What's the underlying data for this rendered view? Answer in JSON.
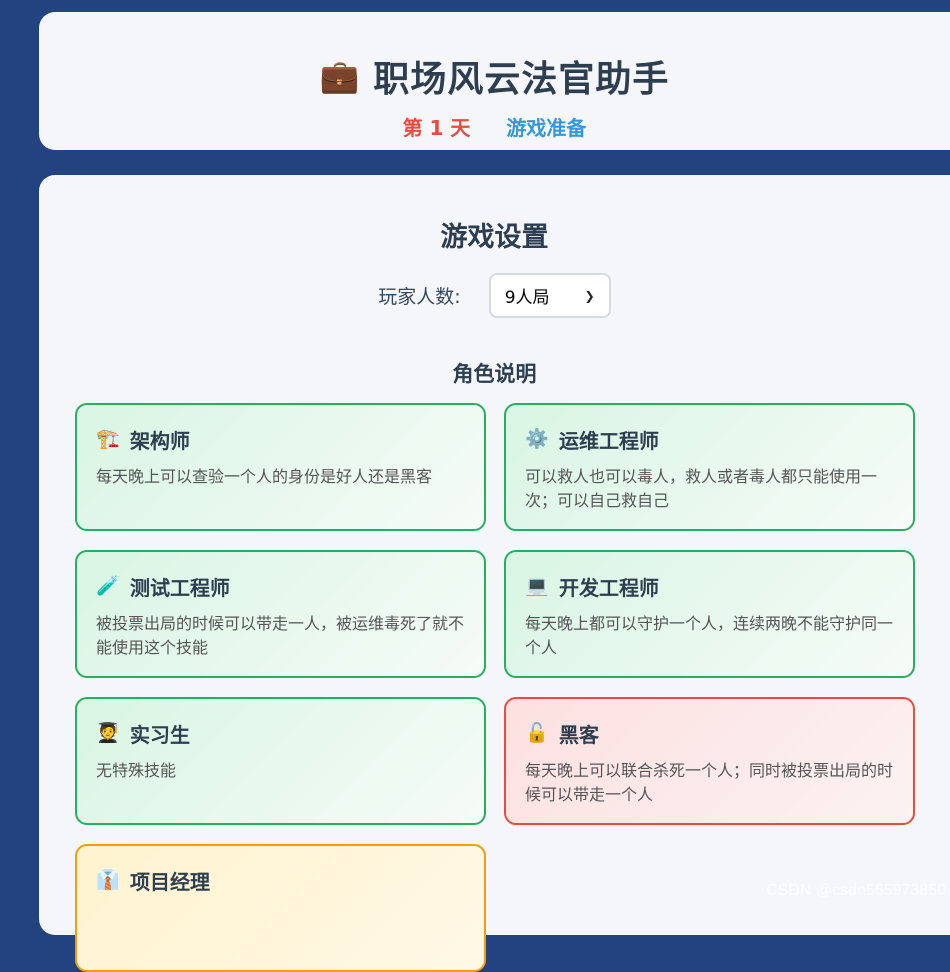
{
  "header": {
    "icon": "briefcase-icon",
    "icon_glyph": "💼",
    "title": "职场风云法官助手",
    "day": "第 1 天",
    "phase": "游戏准备"
  },
  "settings": {
    "title": "游戏设置",
    "players_label": "玩家人数:",
    "players_value": "9人局",
    "roles_title": "角色说明"
  },
  "roles": [
    {
      "icon": "crane-icon",
      "glyph": "🏗️",
      "name": "架构师",
      "desc": "每天晚上可以查验一个人的身份是好人还是黑客",
      "team": "good"
    },
    {
      "icon": "gear-icon",
      "glyph": "⚙️",
      "name": "运维工程师",
      "desc": "可以救人也可以毒人，救人或者毒人都只能使用一次；可以自己救自己",
      "team": "good"
    },
    {
      "icon": "test-tube-icon",
      "glyph": "🧪",
      "name": "测试工程师",
      "desc": "被投票出局的时候可以带走一人，被运维毒死了就不能使用这个技能",
      "team": "good"
    },
    {
      "icon": "laptop-icon",
      "glyph": "💻",
      "name": "开发工程师",
      "desc": "每天晚上都可以守护一个人，连续两晚不能守护同一个人",
      "team": "good"
    },
    {
      "icon": "student-icon",
      "glyph": "🧑‍🎓",
      "name": "实习生",
      "desc": "无特殊技能",
      "team": "good"
    },
    {
      "icon": "unlock-icon",
      "glyph": "🔓",
      "name": "黑客",
      "desc": "每天晚上可以联合杀死一个人；同时被投票出局的时候可以带走一个人",
      "team": "evil"
    },
    {
      "icon": "suit-icon",
      "glyph": "👔",
      "name": "项目经理",
      "desc": "",
      "team": "special"
    }
  ],
  "watermark": "CSDN @csdn565973850"
}
